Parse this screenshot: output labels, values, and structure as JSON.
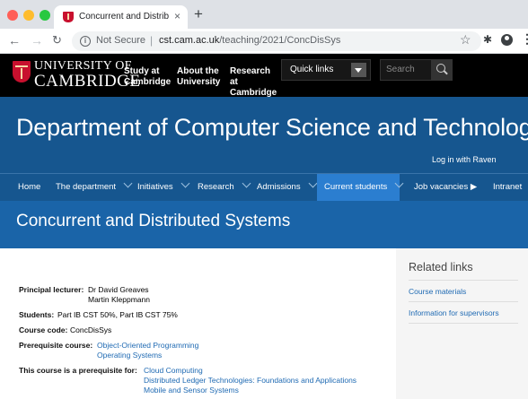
{
  "browser": {
    "tab_title": "Concurrent and Distributed Sy",
    "tab_close": "×",
    "new_tab": "+",
    "nav": {
      "back": "←",
      "forward": "→",
      "reload": "C"
    },
    "security_label": "Not Secure",
    "url_host": "cst.cam.ac.uk",
    "url_path": "/teaching/2021/ConcDisSys",
    "bookmark_icon": "star-icon",
    "extensions_icon": "puzzle-icon"
  },
  "header": {
    "logo_line1": "UNIVERSITY OF",
    "logo_line2": "CAMBRIDGE",
    "links": [
      {
        "label": "Study at Cambridge"
      },
      {
        "label": "About the University"
      },
      {
        "label": "Research at Cambridge"
      }
    ],
    "quick_links": "Quick links",
    "search_placeholder": "Search"
  },
  "department": {
    "title": "Department of Computer Science and Technology",
    "login": "Log in with Raven"
  },
  "nav": {
    "items": [
      {
        "label": "Home"
      },
      {
        "label": "The department"
      },
      {
        "label": "Initiatives"
      },
      {
        "label": "Research"
      },
      {
        "label": "Admissions"
      },
      {
        "label": "Current students"
      },
      {
        "label": "Job vacancies"
      },
      {
        "label": "Intranet"
      }
    ]
  },
  "page": {
    "title": "Concurrent and Distributed Systems"
  },
  "course": {
    "principal_label": "Principal lecturer:",
    "lecturers": [
      "Dr David Greaves",
      "Martin Kleppmann"
    ],
    "students_label": "Students:",
    "students_value": "Part IB CST 50%, Part IB CST 75%",
    "code_label": "Course code:",
    "code_value": "ConcDisSys",
    "prereq_label": "Prerequisite course:",
    "prereqs": [
      "Object-Oriented Programming",
      "Operating Systems"
    ],
    "prereq_for_label": "This course is a prerequisite for:",
    "prereq_for": [
      "Cloud Computing",
      "Distributed Ledger Technologies: Foundations and Applications",
      "Mobile and Sensor Systems"
    ]
  },
  "sidebar": {
    "heading": "Related links",
    "links": [
      {
        "label": "Course materials"
      },
      {
        "label": "Information for supervisors"
      }
    ]
  }
}
